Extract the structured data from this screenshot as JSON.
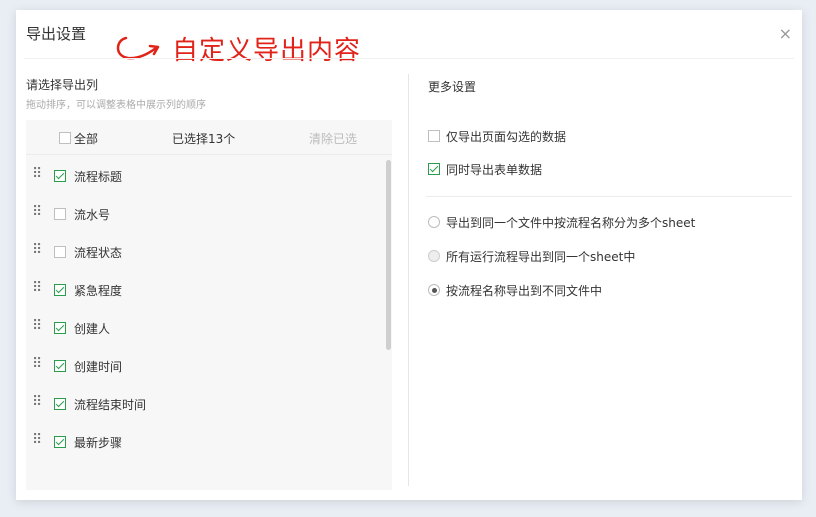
{
  "dialog": {
    "title": "导出设置",
    "close_glyph": "×"
  },
  "annotation": {
    "text": "自定义导出内容",
    "color": "#e2231a"
  },
  "left": {
    "title": "请选择导出列",
    "hint": "拖动排序，可以调整表格中展示列的顺序",
    "select_all_label": "全部",
    "selected_count": "已选择13个",
    "clear_label": "清除已选",
    "columns": [
      {
        "label": "流程标题",
        "checked": true
      },
      {
        "label": "流水号",
        "checked": false
      },
      {
        "label": "流程状态",
        "checked": false
      },
      {
        "label": "紧急程度",
        "checked": true
      },
      {
        "label": "创建人",
        "checked": true
      },
      {
        "label": "创建时间",
        "checked": true
      },
      {
        "label": "流程结束时间",
        "checked": true
      },
      {
        "label": "最新步骤",
        "checked": true
      }
    ]
  },
  "right": {
    "title": "更多设置",
    "options": [
      {
        "label": "仅导出页面勾选的数据",
        "checked": false
      },
      {
        "label": "同时导出表单数据",
        "checked": true
      }
    ],
    "modes": [
      {
        "label": "导出到同一个文件中按流程名称分为多个sheet",
        "selected": false,
        "disabled": false
      },
      {
        "label": "所有运行流程导出到同一个sheet中",
        "selected": false,
        "disabled": true
      },
      {
        "label": "按流程名称导出到不同文件中",
        "selected": true,
        "disabled": false
      }
    ]
  },
  "icons": {
    "drag": "drag-handle-icon",
    "close": "close-icon",
    "arrow": "curved-arrow-icon"
  },
  "colors": {
    "check": "#2a9d4a",
    "annotation": "#e2231a"
  }
}
